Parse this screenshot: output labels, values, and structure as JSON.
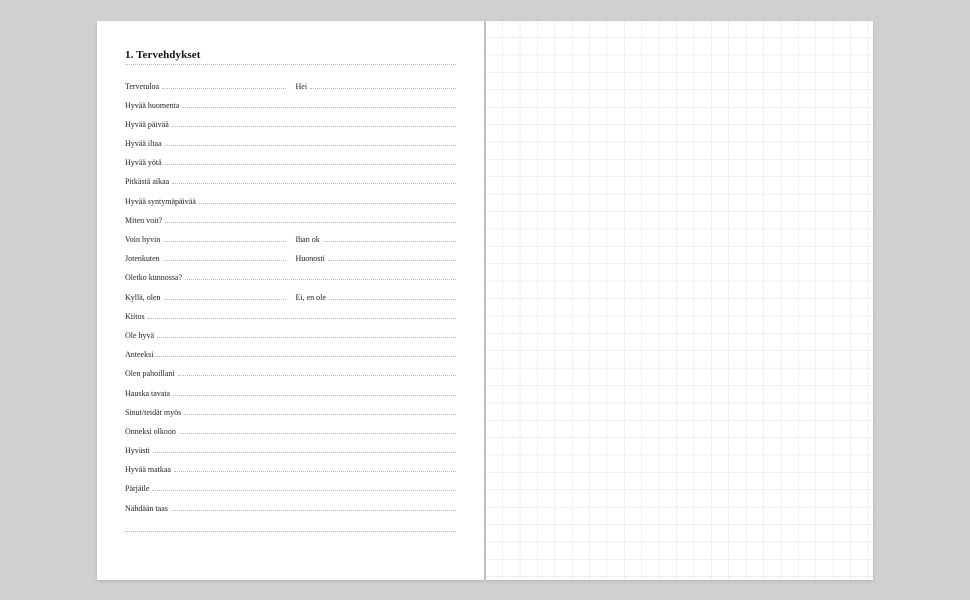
{
  "heading": "1. Tervehdykset",
  "rows": [
    {
      "type": "split",
      "left": "Tervetuloa",
      "right": "Hei"
    },
    {
      "type": "single",
      "text": "Hyvää huomenta"
    },
    {
      "type": "single",
      "text": "Hyvää päivää"
    },
    {
      "type": "single",
      "text": "Hyvää iltaa"
    },
    {
      "type": "single",
      "text": "Hyvää yötä"
    },
    {
      "type": "single",
      "text": "Pitkästä aikaa"
    },
    {
      "type": "single",
      "text": "Hyvää syntymäpäivää"
    },
    {
      "type": "single",
      "text": "Miten voit?"
    },
    {
      "type": "split",
      "left": "Voin hyvin",
      "right": "Ihan ok"
    },
    {
      "type": "split",
      "left": "Jotenkuten",
      "right": "Huonosti"
    },
    {
      "type": "single",
      "text": "Oletko kunnossa?"
    },
    {
      "type": "split",
      "left": "Kyllä, olen",
      "right": "Ei, en ole"
    },
    {
      "type": "single",
      "text": "Kiitos"
    },
    {
      "type": "single",
      "text": "Ole hyvä"
    },
    {
      "type": "single",
      "text": "Anteeksi"
    },
    {
      "type": "single",
      "text": "Olen pahoillani"
    },
    {
      "type": "single",
      "text": "Hauska tavata"
    },
    {
      "type": "single",
      "text": "Sinut/teidät myös"
    },
    {
      "type": "single",
      "text": "Onneksi olkoon"
    },
    {
      "type": "single",
      "text": "Hyvästi"
    },
    {
      "type": "single",
      "text": "Hyvää matkaa"
    },
    {
      "type": "single",
      "text": "Pärjäile"
    },
    {
      "type": "single",
      "text": "Nähdään taas"
    }
  ]
}
